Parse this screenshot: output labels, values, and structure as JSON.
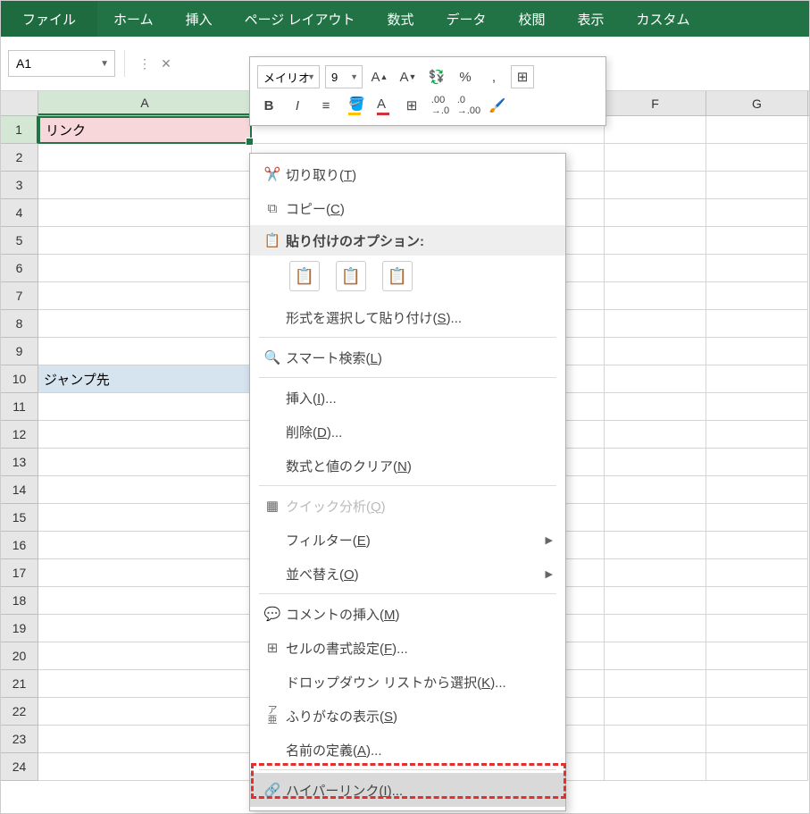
{
  "ribbon": {
    "tabs": [
      "ファイル",
      "ホーム",
      "挿入",
      "ページ レイアウト",
      "数式",
      "データ",
      "校閲",
      "表示",
      "カスタム"
    ]
  },
  "namebox": {
    "value": "A1"
  },
  "mini_toolbar": {
    "font_name": "メイリオ",
    "font_size": "9",
    "bold": "B",
    "italic": "I",
    "fontcolor_letter": "A",
    "percent": "%"
  },
  "columns": {
    "A_width": 239,
    "F_width": 114,
    "G_width": 114,
    "labels": {
      "A": "A",
      "F": "F",
      "G": "G"
    }
  },
  "rows": {
    "count": 24
  },
  "cells": {
    "A1": "リンク",
    "A10": "ジャンプ先"
  },
  "context_menu": {
    "cut": "切り取り(T)",
    "copy": "コピー(C)",
    "paste_header": "貼り付けのオプション:",
    "paste_special": "形式を選択して貼り付け(S)...",
    "smart_lookup": "スマート検索(L)",
    "insert": "挿入(I)...",
    "delete": "削除(D)...",
    "clear": "数式と値のクリア(N)",
    "quick_analysis": "クイック分析(Q)",
    "filter": "フィルター(E)",
    "sort": "並べ替え(O)",
    "insert_comment": "コメントの挿入(M)",
    "format_cells": "セルの書式設定(F)...",
    "dropdown_pick": "ドロップダウン リストから選択(K)...",
    "phonetic": "ふりがなの表示(S)",
    "define_name": "名前の定義(A)...",
    "hyperlink": "ハイパーリンク(I)..."
  }
}
